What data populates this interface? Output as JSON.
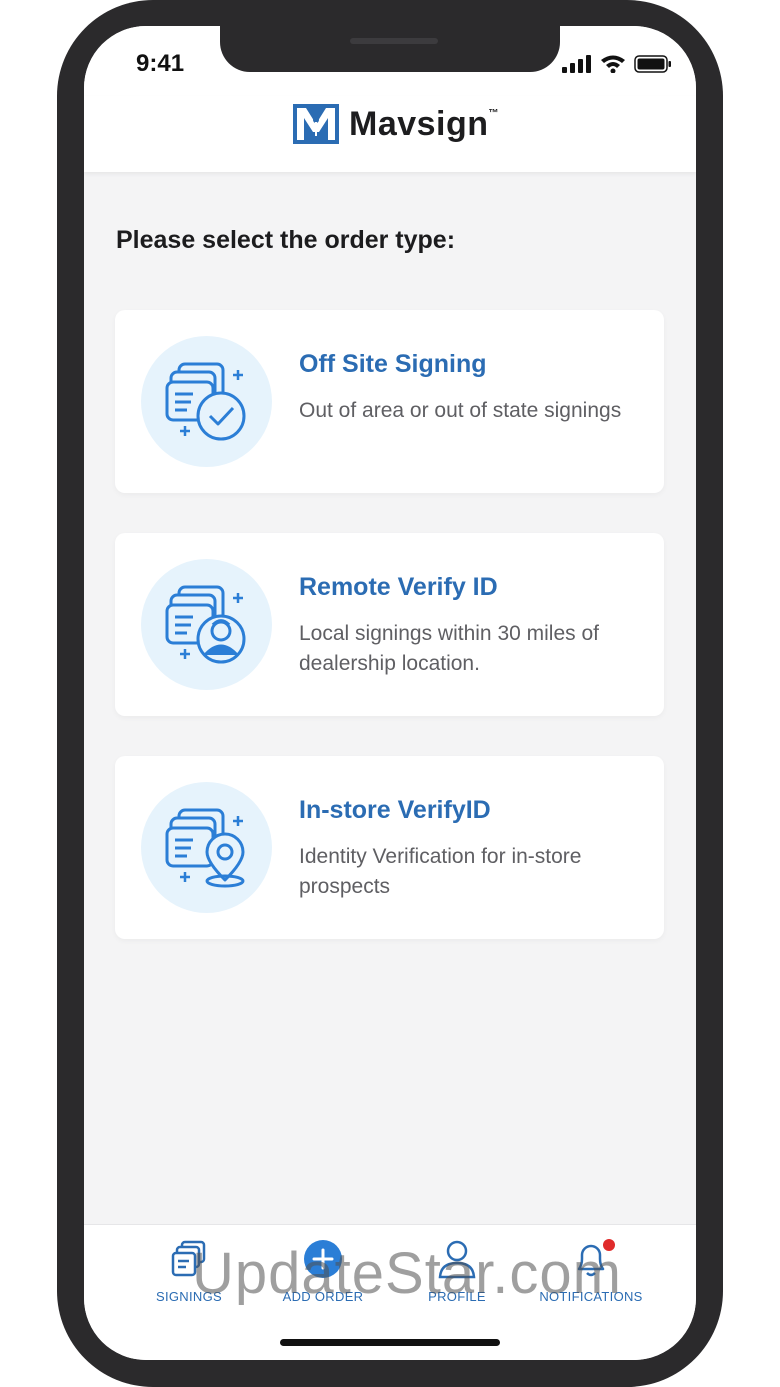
{
  "status": {
    "time": "9:41"
  },
  "brand": {
    "name": "Mavsign",
    "tm": "™",
    "color": "#2b6cb3"
  },
  "prompt": "Please select the order type:",
  "order_types": [
    {
      "title": "Off Site Signing",
      "description": "Out of area or out of state signings",
      "icon": "documents-check-icon"
    },
    {
      "title": "Remote Verify ID",
      "description": "Local signings within 30 miles of dealership location.",
      "icon": "documents-person-icon"
    },
    {
      "title": "In-store VerifyID",
      "description": "Identity Verification for in-store prospects",
      "icon": "documents-location-icon"
    }
  ],
  "tabs": [
    {
      "label": "SIGNINGS",
      "icon": "documents-icon"
    },
    {
      "label": "ADD ORDER",
      "icon": "plus-circle-icon"
    },
    {
      "label": "PROFILE",
      "icon": "user-icon"
    },
    {
      "label": "NOTIFICATIONS",
      "icon": "bell-icon"
    }
  ],
  "watermark": "UpdateStar.com"
}
